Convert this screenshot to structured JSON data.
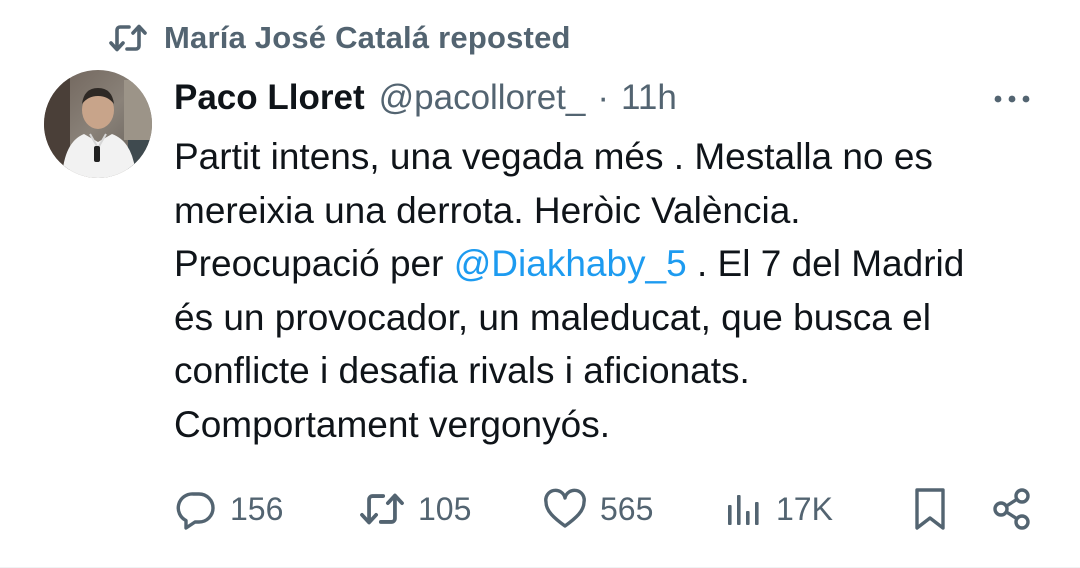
{
  "repost": {
    "icon": "repost-icon",
    "text": "María José Catalá reposted"
  },
  "tweet": {
    "author": {
      "name": "Paco Lloret",
      "handle": "@pacolloret_",
      "avatar_icon": "avatar-photo"
    },
    "separator": "·",
    "time": "11h",
    "more_icon": "more-dots-icon",
    "text": {
      "line1": "Partit intens, una vegada més . Mestalla no es",
      "line2": "mereixia una derrota. Heròic València.",
      "line3_before": "Preocupació per ",
      "mention": "@Diakhaby_5",
      "line3_after": " . El 7 del Madrid",
      "line4": "és un provocador, un maleducat, que busca el",
      "line5": "conflicte i desafia rivals i aficionats.",
      "line6": "Comportament vergonyós."
    },
    "actions": {
      "replies": "156",
      "reposts": "105",
      "likes": "565",
      "views": "17K",
      "bookmark_icon": "bookmark-icon",
      "share_icon": "share-icon"
    }
  },
  "colors": {
    "text_primary": "#0f1419",
    "text_secondary": "#536471",
    "link": "#1d9bf0"
  }
}
